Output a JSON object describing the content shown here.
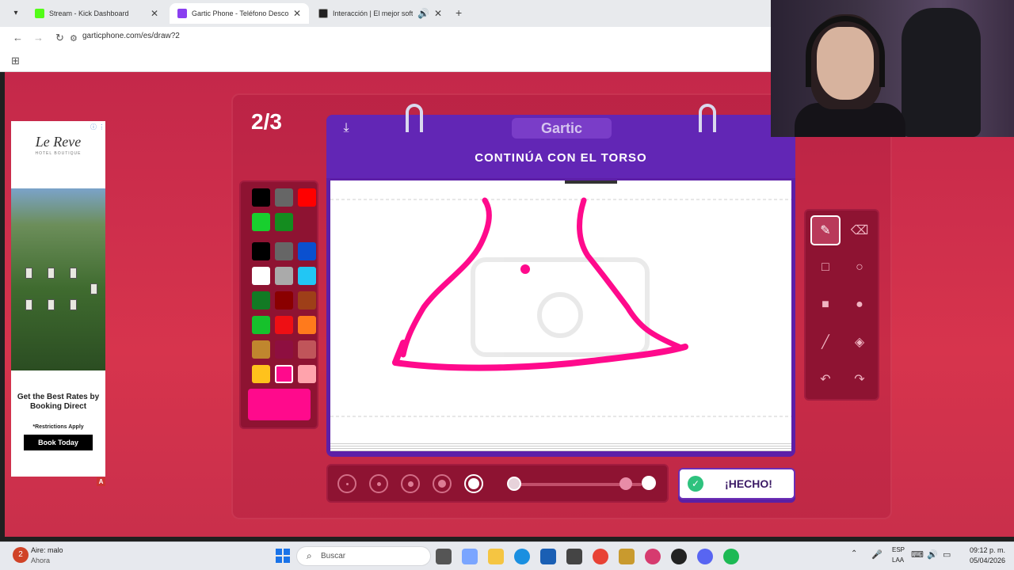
{
  "browser": {
    "tabs": [
      {
        "title": "Stream - Kick Dashboard",
        "favicon_color": "#53fc18",
        "active": false
      },
      {
        "title": "Gartic Phone - Teléfono Descon",
        "favicon_color": "#8a3ff0",
        "active": true
      },
      {
        "title": "Interacción | El mejor softw",
        "favicon_color": "#222222",
        "active": false
      }
    ],
    "url": "garticphone.com/es/draw?2"
  },
  "ad": {
    "logo": "Le Reve",
    "logo_sub": "HOTEL BOUTIQUE",
    "headline": "Get the Best Rates by Booking Direct",
    "restrictions": "*Restrictions Apply",
    "cta": "Book Today"
  },
  "game": {
    "round": "2/3",
    "logo": "Gartic",
    "instruction": "CONTINÚA CON EL TORSO",
    "done_label": "¡HECHO!",
    "selected_color": "#ff0a8c",
    "selected_tool": "pencil",
    "selected_brush_size": 5,
    "palette": [
      "#000000",
      "#666666",
      "#ff0000",
      "#18cf2e",
      "#148c1f",
      "#000000",
      "#666666",
      "#0a50d0",
      "#ffffff",
      "#aaaaaa",
      "#22c6f4",
      "#127a24",
      "#8a0000",
      "#9e3f18",
      "#16c12c",
      "#ee0f14",
      "#ff7a1c",
      "#c0862e",
      "#8e0f40",
      "#c0555a",
      "#ffc21c",
      "#ff0a8c",
      "#ffa3ac"
    ],
    "tools": [
      "pencil",
      "eraser",
      "rect-outline",
      "circle-outline",
      "rect-filled",
      "circle-filled",
      "line",
      "fill",
      "undo",
      "redo"
    ]
  },
  "taskbar": {
    "weather_title": "Aire: malo",
    "weather_sub": "Ahora",
    "search_placeholder": "Buscar",
    "lang_top": "ESP",
    "lang_bottom": "LAA",
    "time": "09:12 p. m.",
    "date": "05/04/2026"
  }
}
